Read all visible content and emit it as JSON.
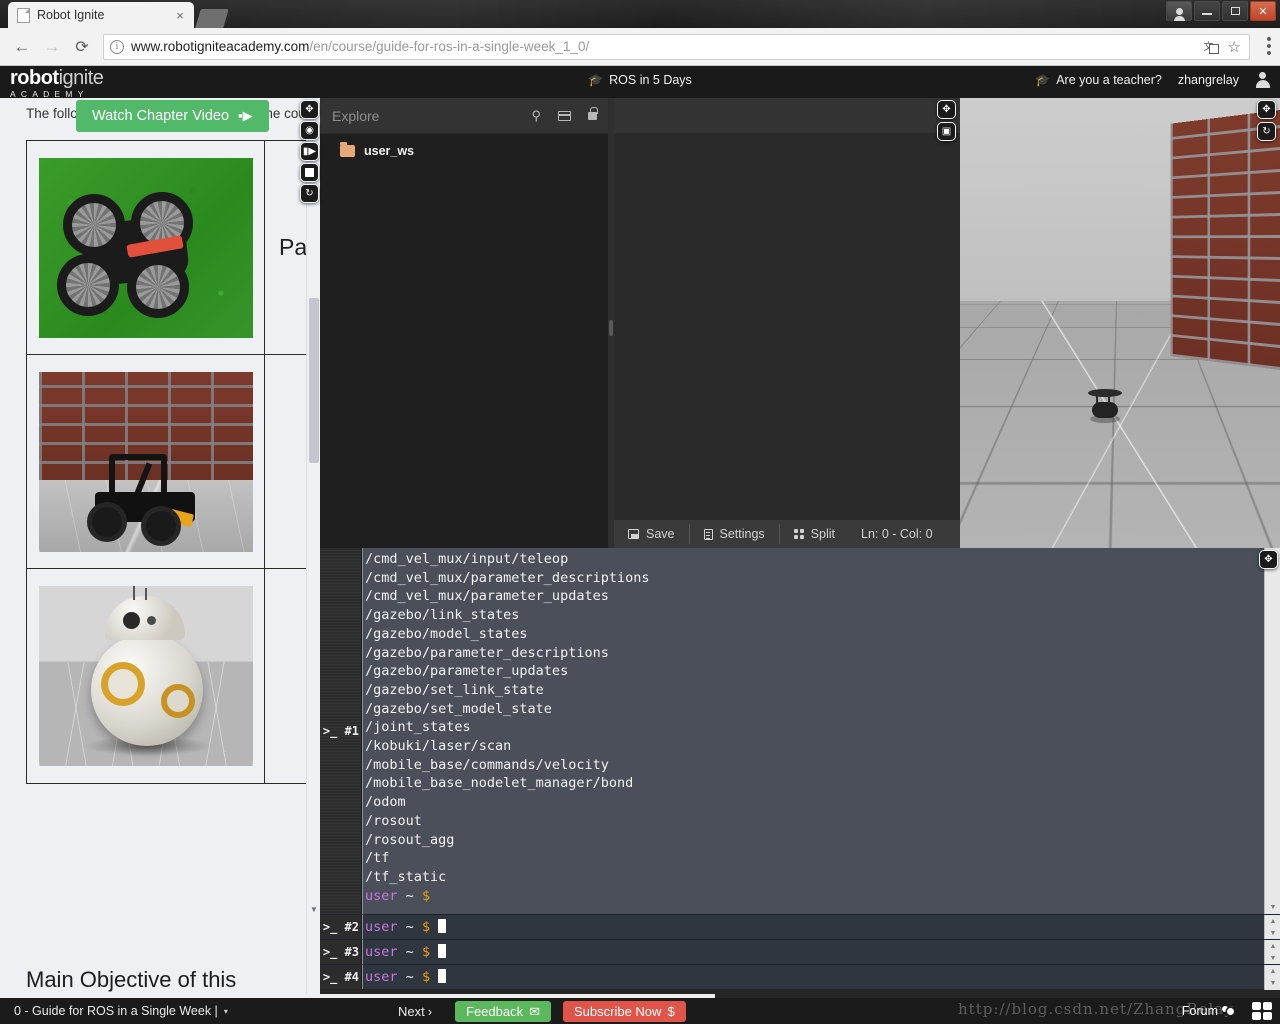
{
  "browser": {
    "tab_title": "Robot Ignite",
    "tab_close": "×",
    "back_icon": "←",
    "forward_icon": "→",
    "reload_icon": "⟳",
    "url_host": "www.robotigniteacademy.com",
    "url_path": "/en/course/guide-for-ros-in-a-single-week_1_0/",
    "star_icon": "☆",
    "info_icon": "i",
    "window_minimize": "–",
    "window_maximize": "❐",
    "window_close": "✕"
  },
  "site_header": {
    "logo_robot": "robot",
    "logo_ignite": "ignite",
    "logo_sub": "ACADEMY",
    "course_label": "ROS in 5 Days",
    "cap_icon": "🎓",
    "teacher_link": "Are you a teacher?",
    "username": "zhangrelay"
  },
  "course_content": {
    "top_text": "The following robots will be used along the course:",
    "watch_button": "Watch Chapter Video",
    "watch_icon": "■▶",
    "table_right_cell": "Par",
    "main_heading": "Main Objective of this course",
    "robot_images": [
      "drone-on-grass",
      "rover-by-brick-wall",
      "bb8-robot"
    ]
  },
  "sim_controls": {
    "expand_icon": "⤡",
    "hide_icon": "◉",
    "next_icon": "▶|",
    "stop_icon": "■",
    "reset_icon": "⟳",
    "screen_icon": "🖥"
  },
  "ide": {
    "explore_title": "Explore",
    "search_icon": "⚲",
    "archive_icon": "archive-box",
    "lock_icon": "lock",
    "files": [
      {
        "name": "user_ws",
        "type": "folder"
      }
    ],
    "statusbar": {
      "save_label": "Save",
      "settings_label": "Settings",
      "split_label": "Split",
      "position_label": "Ln: 0 - Col: 0"
    }
  },
  "terminal": {
    "tabs": [
      "#1",
      "#2",
      "#3",
      "#4"
    ],
    "output_lines": [
      "/cmd_vel_mux/input/teleop",
      "/cmd_vel_mux/parameter_descriptions",
      "/cmd_vel_mux/parameter_updates",
      "/gazebo/link_states",
      "/gazebo/model_states",
      "/gazebo/parameter_descriptions",
      "/gazebo/parameter_updates",
      "/gazebo/set_link_state",
      "/gazebo/set_model_state",
      "/joint_states",
      "/kobuki/laser/scan",
      "/mobile_base/commands/velocity",
      "/mobile_base_nodelet_manager/bond",
      "/odom",
      "/rosout",
      "/rosout_agg",
      "/tf",
      "/tf_static"
    ],
    "prompt_user": "user",
    "prompt_tilde": "~",
    "prompt_dollar": "$"
  },
  "bottombar": {
    "chapter_label": "0 - Guide for ROS in a Single Week |",
    "caret": "▾",
    "next_label": "Next",
    "next_caret": "›",
    "feedback_label": "Feedback",
    "feedback_icon": "✉",
    "subscribe_label": "Subscribe Now",
    "subscribe_icon": "$",
    "watermark": "http://blog.csdn.net/ZhangRelay",
    "forum_label": "Forum"
  },
  "colors": {
    "brand_dark": "#1a1a1a",
    "accent_green": "#5cb85c",
    "accent_red": "#e0544a",
    "watch_green": "#53b96a",
    "terminal_bg": "#4a4f59",
    "prompt_user": "#c678dd",
    "prompt_dollar": "#e5a00d"
  }
}
